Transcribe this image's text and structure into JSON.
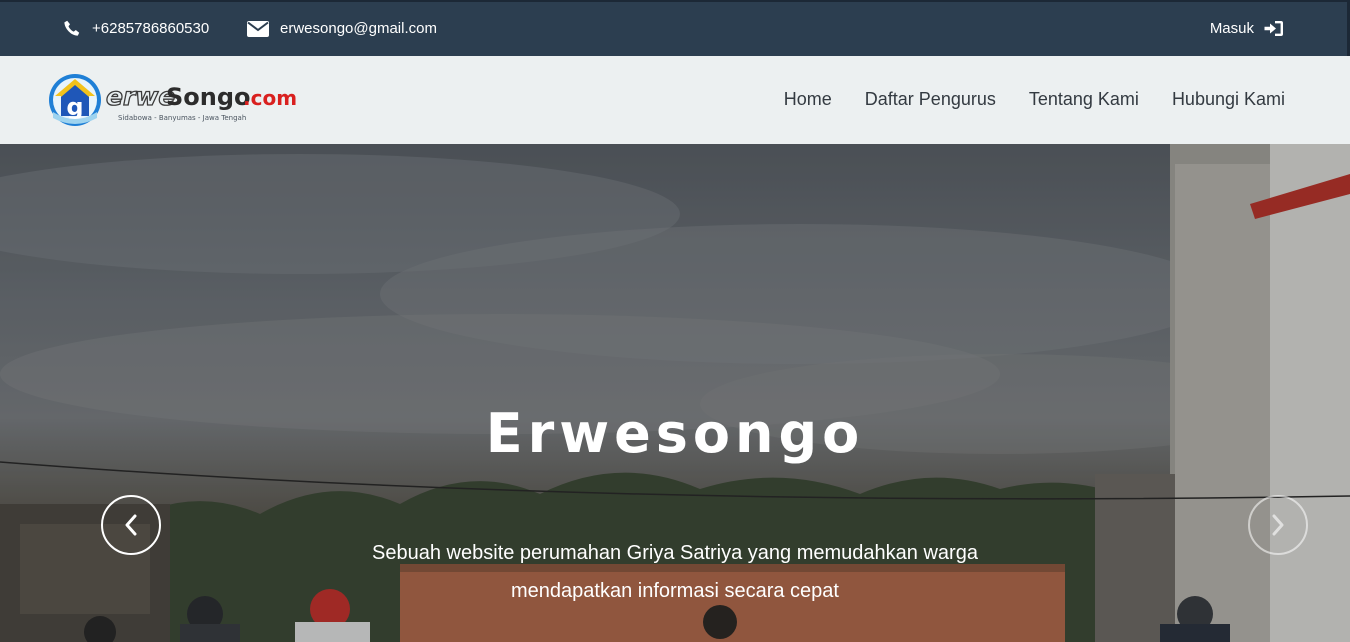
{
  "topbar": {
    "phone": "+6285786860530",
    "email": "erwesongo@gmail.com",
    "login_label": "Masuk",
    "icons": {
      "phone": "phone-icon",
      "email": "envelope-icon",
      "login": "sign-in-icon"
    }
  },
  "logo": {
    "text_part1": "erwe",
    "text_part2": "Songo",
    "text_part3": ".com",
    "tagline": "Sidabowa - Banyumas - Jawa Tengah"
  },
  "nav": {
    "items": [
      {
        "label": "Home"
      },
      {
        "label": "Daftar Pengurus"
      },
      {
        "label": "Tentang Kami"
      },
      {
        "label": "Hubungi Kami"
      }
    ]
  },
  "hero": {
    "title": "Erwesongo",
    "subtitle_line1": "Sebuah website perumahan Griya Satriya yang memudahkan warga",
    "subtitle_line2": "mendapatkan informasi secara cepat",
    "prev_icon": "chevron-left-icon",
    "next_icon": "chevron-right-icon"
  },
  "colors": {
    "topbar_bg": "#2c3e50",
    "navbar_bg": "#ecf0f1",
    "nav_text": "#333a41",
    "logo_blue": "#1f57b8",
    "logo_red": "#d9201f",
    "logo_yellow": "#f3c21b"
  }
}
